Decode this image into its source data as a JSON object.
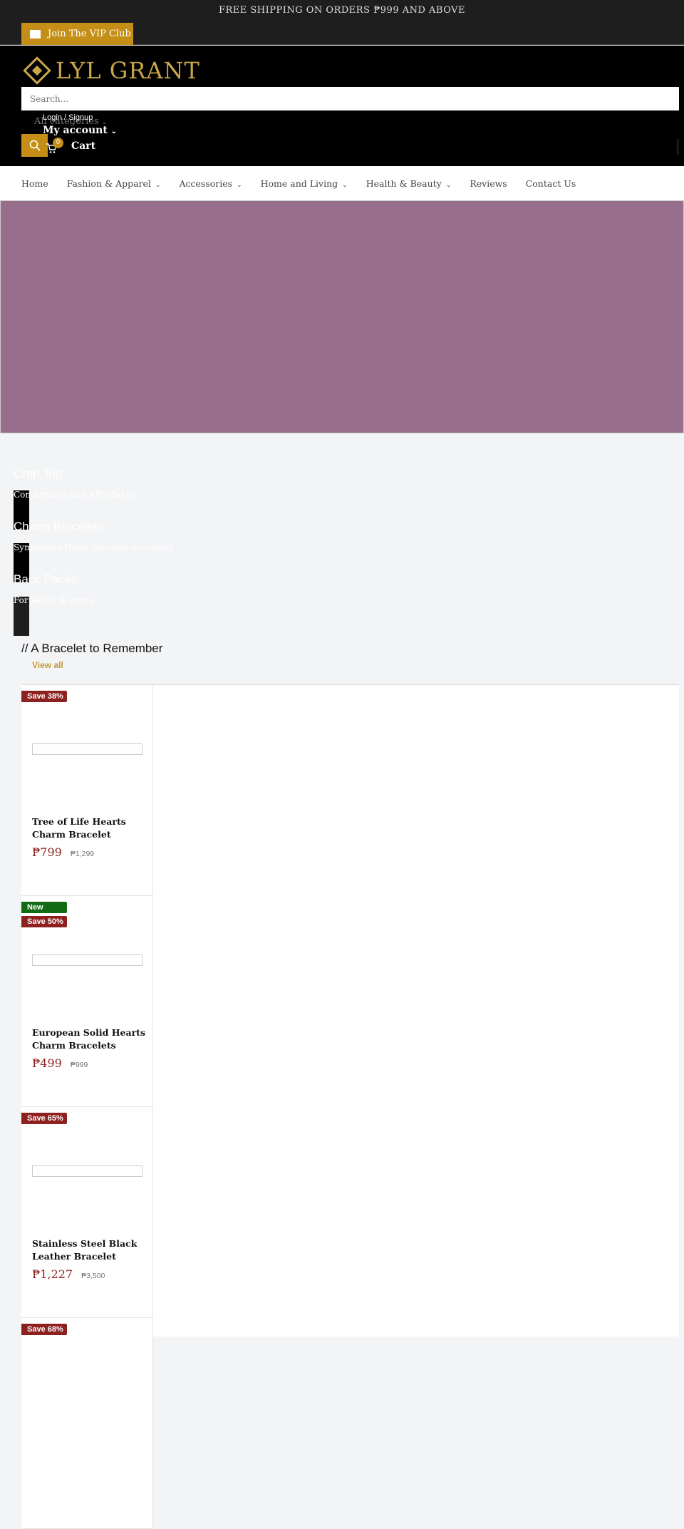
{
  "announcement": "FREE SHIPPING ON ORDERS ₱999 AND ABOVE",
  "vip": {
    "label": "Join The VIP Club",
    "icon": "mail-icon"
  },
  "brand": {
    "logo": "LYL GRANT",
    "accent": "#c58f17"
  },
  "search": {
    "placeholder": "Search...",
    "category": "All categories"
  },
  "account": {
    "login": "Login / Signup",
    "label": "My account"
  },
  "cart": {
    "label": "Cart",
    "count": "0"
  },
  "nav": [
    {
      "label": "Home",
      "dropdown": false
    },
    {
      "label": "Fashion & Apparel",
      "dropdown": true
    },
    {
      "label": "Accessories",
      "dropdown": true
    },
    {
      "label": "Home and Living",
      "dropdown": true
    },
    {
      "label": "Health & Beauty",
      "dropdown": true
    },
    {
      "label": "Reviews",
      "dropdown": false
    },
    {
      "label": "Contact Us",
      "dropdown": false
    }
  ],
  "hero": {
    "color": "#976f8c"
  },
  "slides": [
    {
      "title": "Crop Top",
      "subtitle": "Comfortable and Affordable"
    },
    {
      "title": "Charm Bracelets",
      "subtitle": "Symbolizes those precious occasions"
    },
    {
      "title": "Back Packs",
      "subtitle": "For ladies & gents"
    }
  ],
  "section": {
    "title": "// A Bracelet to Remember",
    "view_all": "View all"
  },
  "products": [
    {
      "badges": [
        {
          "text": "Save 38%",
          "type": "save"
        }
      ],
      "name": "Tree of Life Hearts Charm Bracelet",
      "price": "₱799",
      "compare": "₱1,299"
    },
    {
      "badges": [
        {
          "text": "New",
          "type": "new"
        },
        {
          "text": "Save 50%",
          "type": "save"
        }
      ],
      "name": "European Solid Hearts Charm Bracelets",
      "price": "₱499",
      "compare": "₱999"
    },
    {
      "badges": [
        {
          "text": "Save 65%",
          "type": "save"
        }
      ],
      "name": "Stainless Steel Black Leather Bracelet",
      "price": "₱1,227",
      "compare": "₱3,500"
    },
    {
      "badges": [
        {
          "text": "Save 68%",
          "type": "save"
        }
      ]
    }
  ]
}
